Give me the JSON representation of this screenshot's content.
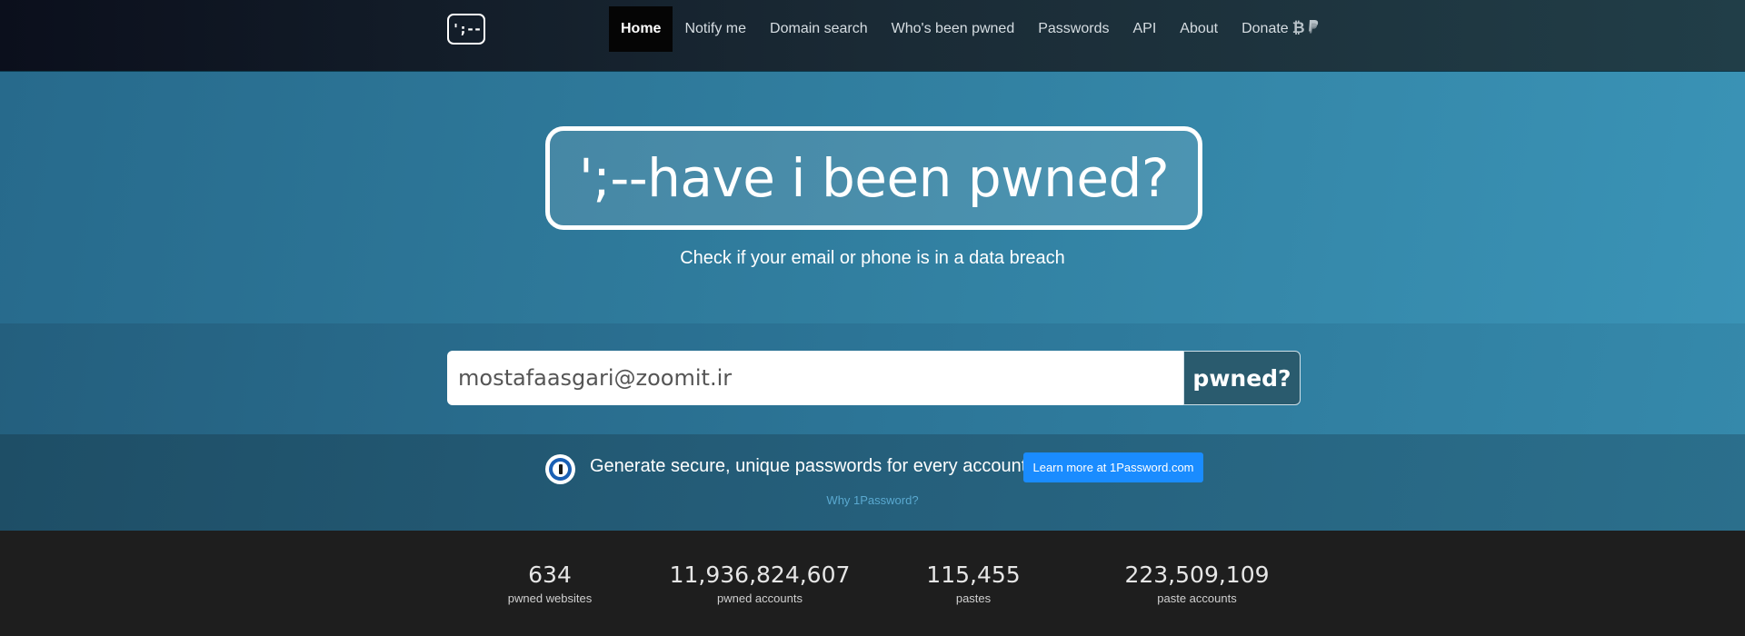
{
  "nav": {
    "logo_text": "';--",
    "items": [
      {
        "label": "Home"
      },
      {
        "label": "Notify me"
      },
      {
        "label": "Domain search"
      },
      {
        "label": "Who's been pwned"
      },
      {
        "label": "Passwords"
      },
      {
        "label": "API"
      },
      {
        "label": "About"
      },
      {
        "label": "Donate"
      }
    ],
    "active_index": 0,
    "donate_icons": [
      "bitcoin-icon",
      "paypal-icon"
    ]
  },
  "hero": {
    "title": "';--have i been pwned?",
    "subtitle": "Check if your email or phone is in a data breach"
  },
  "search": {
    "value": "mostafaasgari@zoomit.ir",
    "button_label": "pwned?"
  },
  "promo": {
    "icon": "1password-icon",
    "text": "Generate secure, unique passwords for every account",
    "button_label": "Learn more at 1Password.com",
    "link_label": "Why 1Password?",
    "button_color": "#1a8cff"
  },
  "stats": [
    {
      "value": "634",
      "label": "pwned websites"
    },
    {
      "value": "11,936,824,607",
      "label": "pwned accounts"
    },
    {
      "value": "115,455",
      "label": "pastes"
    },
    {
      "value": "223,509,109",
      "label": "paste accounts"
    }
  ]
}
